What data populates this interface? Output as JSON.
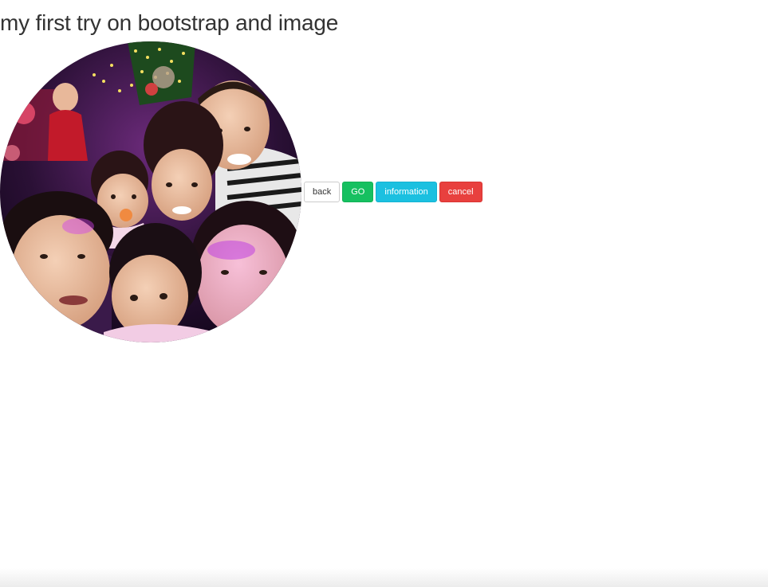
{
  "page": {
    "title": "my first try on bootstrap and image"
  },
  "image": {
    "description_icon": "family-photo"
  },
  "buttons": {
    "back": "back",
    "go": "GO",
    "information": "information",
    "cancel": "cancel"
  },
  "colors": {
    "title": "#333333",
    "go": "#16c060",
    "information": "#1bc0e0",
    "cancel": "#e8403e"
  }
}
